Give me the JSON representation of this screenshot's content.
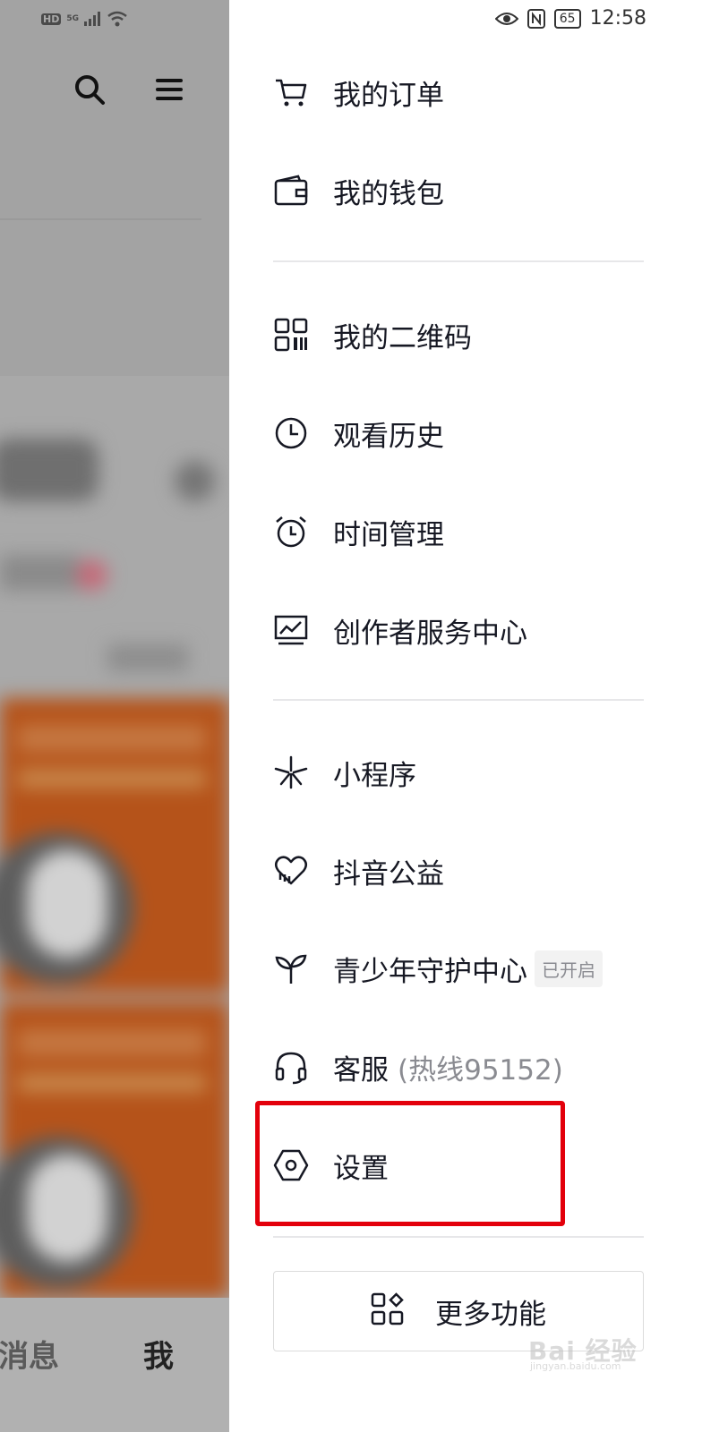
{
  "status_bar": {
    "left_network": "HD",
    "left_5g": "5G",
    "battery": "65",
    "time": "12:58"
  },
  "background_page": {
    "nav_messages": "消息",
    "nav_me": "我"
  },
  "drawer": {
    "items": [
      {
        "label": "我的订单",
        "icon": "cart-icon"
      },
      {
        "label": "我的钱包",
        "icon": "wallet-icon"
      },
      {
        "label": "我的二维码",
        "icon": "qrcode-icon"
      },
      {
        "label": "观看历史",
        "icon": "clock-icon"
      },
      {
        "label": "时间管理",
        "icon": "alarm-clock-icon"
      },
      {
        "label": "创作者服务中心",
        "icon": "creator-monitor-icon"
      },
      {
        "label": "小程序",
        "icon": "mini-program-icon"
      },
      {
        "label": "抖音公益",
        "icon": "charity-heart-icon"
      },
      {
        "label": "青少年守护中心",
        "icon": "sprout-icon",
        "badge": "已开启"
      },
      {
        "label": "客服",
        "hint": "(热线95152)",
        "icon": "headset-icon"
      },
      {
        "label": "设置",
        "icon": "settings-hex-icon"
      }
    ],
    "more_button": {
      "label": "更多功能",
      "icon": "grid-apps-icon"
    }
  },
  "watermark": {
    "text": "Bai 经验",
    "sub": "jingyan.baidu.com"
  }
}
